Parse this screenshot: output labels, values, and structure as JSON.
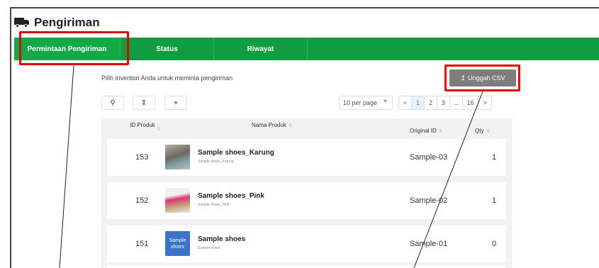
{
  "header": {
    "title": "Pengiriman",
    "icon": "truck-icon"
  },
  "tabs": [
    {
      "label": "Permintaan Pengiriman",
      "active": true
    },
    {
      "label": "Status",
      "active": false
    },
    {
      "label": "Riwayat",
      "active": false
    }
  ],
  "instruction": "Pilih inventori Anda untuk meminta pengiriman",
  "upload_label": "Unggah CSV",
  "upload_icon": "↥",
  "toolbar": {
    "search_icon": "⚲",
    "sort_icon": "⇕",
    "tag_icon": "⌖"
  },
  "per_page": "10 per page",
  "pagination": {
    "prev": "<",
    "pages": [
      "1",
      "2",
      "3"
    ],
    "ellipsis": "...",
    "last": "16",
    "next": ">"
  },
  "columns": {
    "id": "ID Produk",
    "name": "Nama Produk",
    "original_id": "Original ID",
    "qty": "Qty"
  },
  "rows": [
    {
      "id": "153",
      "name": "Sample shoes_Karung",
      "sub": "Sample shoes_Karung",
      "original_id": "Sample-03",
      "qty": "1"
    },
    {
      "id": "152",
      "name": "Sample shoes_Pink",
      "sub": "Sample shoes_Pink",
      "original_id": "Sample-02",
      "qty": "1"
    },
    {
      "id": "151",
      "name": "Sample shoes",
      "sub": "Sample shoes",
      "original_id": "Sample-01",
      "qty": "0",
      "thumb_text": "Sample shoes"
    }
  ],
  "colors": {
    "nav_green": "#0f9d3f",
    "highlight_red": "#e00000",
    "upload_gray": "#7d7d7d",
    "active_page": "#3a7ccc"
  }
}
